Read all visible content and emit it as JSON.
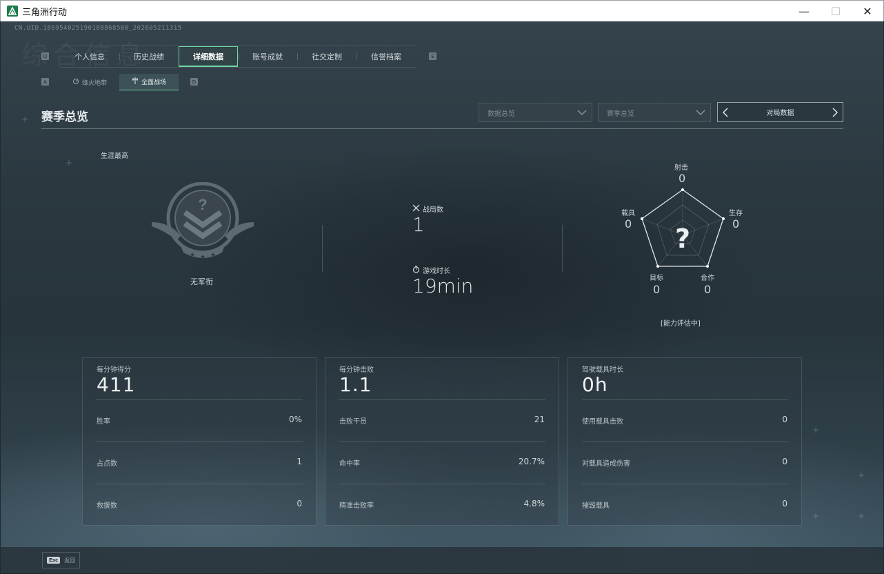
{
  "window": {
    "title": "三角洲行动",
    "minimize": "—",
    "maximize": "☐",
    "close": "✕"
  },
  "uid": "CN.UID.186954025190188868560_202605211315",
  "bg_ghost": "综合信息",
  "tab_keys": {
    "left": "Q",
    "right": "E"
  },
  "tabs": [
    {
      "label": "个人信息",
      "active": false
    },
    {
      "label": "历史战绩",
      "active": false
    },
    {
      "label": "详细数据",
      "active": true
    },
    {
      "label": "账号成就",
      "active": false
    },
    {
      "label": "社交定制",
      "active": false
    },
    {
      "label": "信誉档案",
      "active": false
    }
  ],
  "subtab_keys": {
    "left": "A",
    "right": "D"
  },
  "subtabs": [
    {
      "label": "烽火地带",
      "icon": "radar-icon",
      "active": false
    },
    {
      "label": "全面战场",
      "icon": "crosshair-icon",
      "active": true
    }
  ],
  "section": {
    "title": "赛季总览",
    "dropdown1": "数据总览",
    "dropdown2": "赛季总览",
    "pager": "对局数据"
  },
  "overview": {
    "career_label": "生涯最高",
    "rank_name": "无军衔",
    "matches_label": "战局数",
    "matches_value": "1",
    "playtime_label": "游戏时长",
    "playtime_value": "19min"
  },
  "radar": {
    "shooting": {
      "label": "射击",
      "value": "0"
    },
    "survival": {
      "label": "生存",
      "value": "0"
    },
    "coop": {
      "label": "合作",
      "value": "0"
    },
    "objective": {
      "label": "目标",
      "value": "0"
    },
    "vehicle": {
      "label": "载具",
      "value": "0"
    },
    "unknown_mark": "?",
    "note": "[能力评估中]"
  },
  "cards": [
    {
      "title": "每分钟得分",
      "value": "411",
      "rows": [
        {
          "label": "胜率",
          "value": "0%"
        },
        {
          "label": "占点数",
          "value": "1"
        },
        {
          "label": "救援数",
          "value": "0"
        }
      ]
    },
    {
      "title": "每分钟击败",
      "value": "1.1",
      "rows": [
        {
          "label": "击败干员",
          "value": "21"
        },
        {
          "label": "命中率",
          "value": "20.7%"
        },
        {
          "label": "精准击败率",
          "value": "4.8%"
        }
      ]
    },
    {
      "title": "驾驶载具时长",
      "value": "0h",
      "rows": [
        {
          "label": "使用载具击败",
          "value": "0"
        },
        {
          "label": "对载具造成伤害",
          "value": "0"
        },
        {
          "label": "摧毁载具",
          "value": "0"
        }
      ]
    }
  ],
  "footer": {
    "esc_key": "Esc",
    "back_label": "返回"
  },
  "colors": {
    "accent": "#6fd6a3",
    "bg": "#2b3840"
  }
}
